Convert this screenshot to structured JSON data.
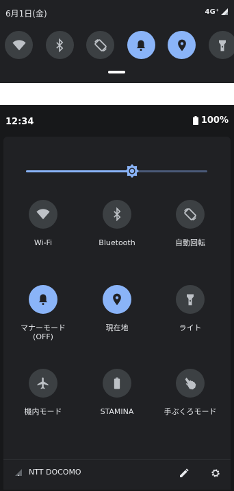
{
  "colors": {
    "accent": "#8ab4f8",
    "panel": "#202124",
    "tile_off": "#3c4043"
  },
  "collapsed": {
    "date": "6月1日(金)",
    "network": "4G⁺",
    "tiles": [
      {
        "icon": "wifi-icon",
        "active": false
      },
      {
        "icon": "bluetooth-icon",
        "active": false
      },
      {
        "icon": "auto-rotate-icon",
        "active": false
      },
      {
        "icon": "bell-icon",
        "active": true
      },
      {
        "icon": "location-icon",
        "active": true
      },
      {
        "icon": "flashlight-icon",
        "active": false
      }
    ]
  },
  "expanded": {
    "time": "12:34",
    "battery": "100%",
    "brightness": 0.58,
    "tiles": [
      {
        "label": "Wi-Fi",
        "icon": "wifi-icon",
        "active": false
      },
      {
        "label": "Bluetooth",
        "icon": "bluetooth-icon",
        "active": false
      },
      {
        "label": "自動回転",
        "icon": "auto-rotate-icon",
        "active": false
      },
      {
        "label": "マナーモード\n(OFF)",
        "icon": "bell-icon",
        "active": true
      },
      {
        "label": "現在地",
        "icon": "location-icon",
        "active": true
      },
      {
        "label": "ライト",
        "icon": "flashlight-icon",
        "active": false
      },
      {
        "label": "機内モード",
        "icon": "airplane-icon",
        "active": false
      },
      {
        "label": "STAMINA",
        "icon": "battery-icon",
        "active": false
      },
      {
        "label": "手ぶくろモード",
        "icon": "glove-icon",
        "active": false
      }
    ],
    "footer": {
      "carrier": "NTT DOCOMO"
    }
  }
}
